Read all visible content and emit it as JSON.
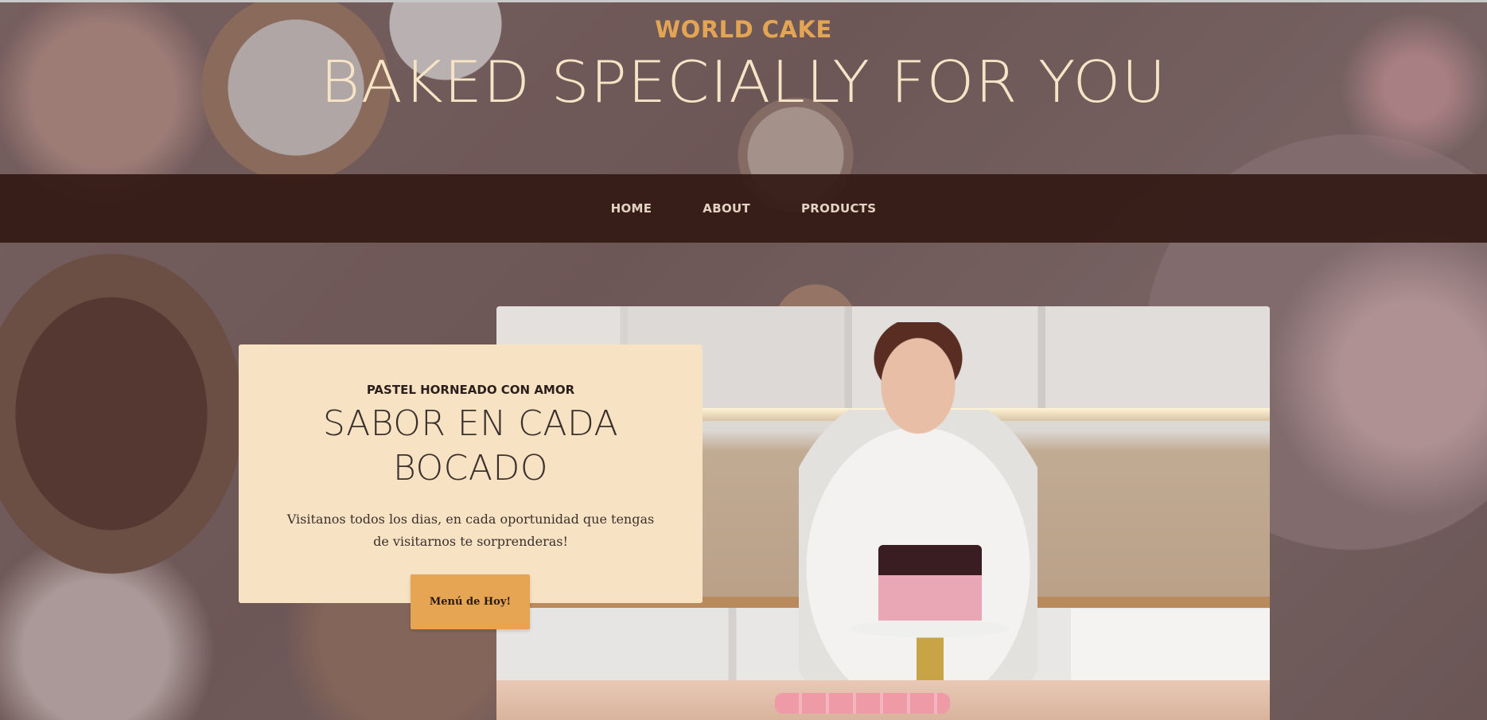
{
  "header": {
    "brand": "WORLD CAKE",
    "headline": "BAKED SPECIALLY FOR YOU"
  },
  "nav": {
    "items": [
      {
        "label": "HOME"
      },
      {
        "label": "ABOUT"
      },
      {
        "label": "PRODUCTS"
      }
    ]
  },
  "promo": {
    "eyebrow": "PASTEL HORNEADO CON AMOR",
    "title": "SABOR EN CADA BOCADO",
    "text": "Visitanos todos los dias, en cada oportunidad que tengas de visitarnos te sorprenderas!",
    "button_label": "Menú de Hoy!"
  },
  "colors": {
    "brand_accent": "#e3a554",
    "headline": "#f7e3c5",
    "navbar": "#341a14",
    "card": "#f8e2c4",
    "button": "#e5a553"
  }
}
